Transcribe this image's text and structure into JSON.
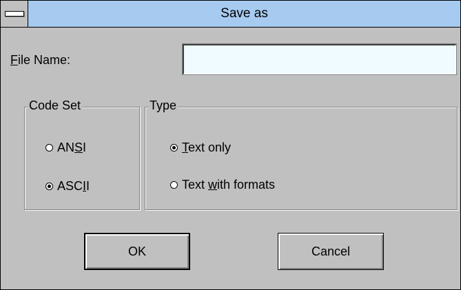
{
  "dialog": {
    "title": "Save as",
    "file_name": {
      "label_accel": "F",
      "label_rest": "ile Name:",
      "value": ""
    },
    "code_set": {
      "legend": "Code Set",
      "options": [
        {
          "pre": "AN",
          "accel": "S",
          "post": "I",
          "checked": false
        },
        {
          "pre": "ASC",
          "accel": "I",
          "post": "I",
          "checked": true
        }
      ]
    },
    "type": {
      "legend": "Type",
      "options": [
        {
          "pre": "",
          "accel": "T",
          "post": "ext only",
          "checked": true
        },
        {
          "pre": "Text ",
          "accel": "w",
          "post": "ith formats",
          "checked": false
        }
      ]
    },
    "buttons": {
      "ok": "OK",
      "cancel": "Cancel"
    }
  },
  "colors": {
    "face": "#c0c0c0",
    "titlebar": "#a6caf0",
    "input_bg": "#f0fbff"
  },
  "icons": {
    "system_menu": "system-menu-icon"
  }
}
